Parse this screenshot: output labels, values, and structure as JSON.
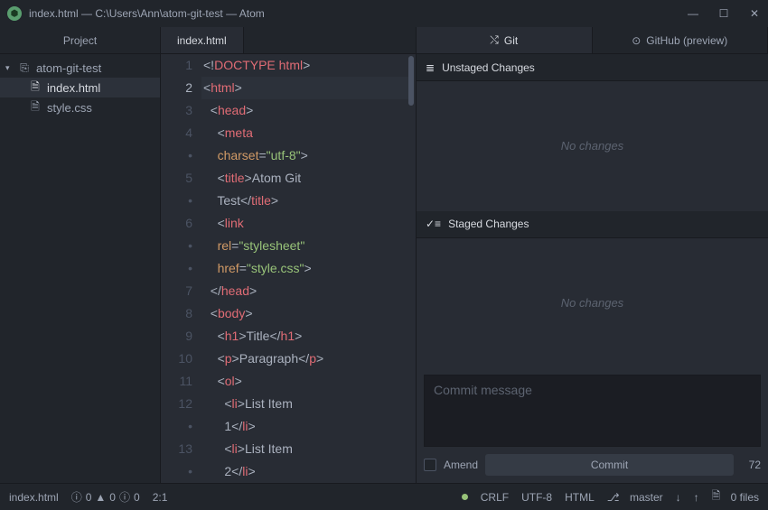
{
  "window": {
    "title": "index.html — C:\\Users\\Ann\\atom-git-test — Atom"
  },
  "project": {
    "header": "Project",
    "root": "atom-git-test",
    "files": [
      "index.html",
      "style.css"
    ],
    "active": "index.html"
  },
  "editor": {
    "tab": "index.html",
    "cursor_line": 2,
    "cursor_pos": "2:1"
  },
  "git": {
    "tabs": {
      "git": "Git",
      "github": "GitHub (preview)"
    },
    "unstaged_header": "Unstaged Changes",
    "staged_header": "Staged Changes",
    "no_changes": "No changes",
    "commit_placeholder": "Commit message",
    "amend_label": "Amend",
    "commit_btn": "Commit",
    "char_count": "72"
  },
  "status": {
    "file": "index.html",
    "diagnostics": {
      "errors": 0,
      "warnings": 0,
      "info": 0
    },
    "line_ending": "CRLF",
    "encoding": "UTF-8",
    "grammar": "HTML",
    "branch": "master",
    "files_count": "0 files"
  }
}
